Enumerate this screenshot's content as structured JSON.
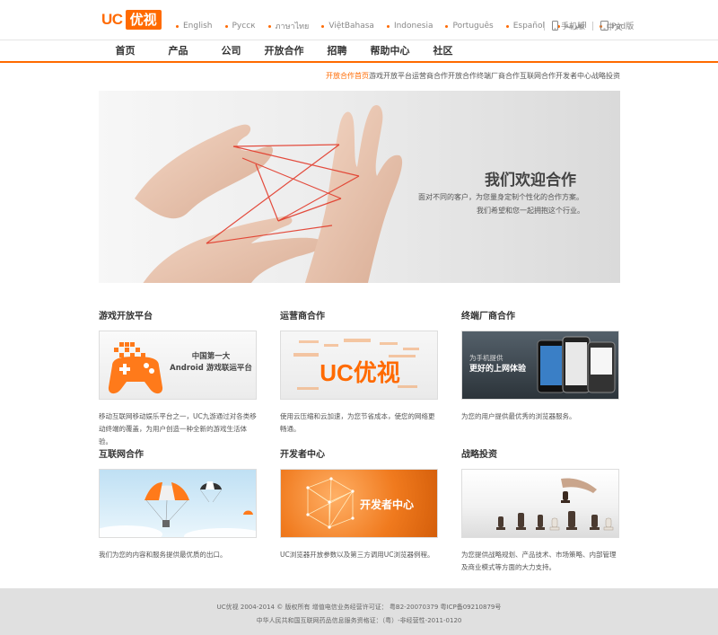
{
  "logo": {
    "uc": "UC",
    "brand": "优视"
  },
  "languages": [
    "English",
    "Русск",
    "ภาษาไทย",
    "ViệtBahasa",
    "Indonesia",
    "Português",
    "Español",
    "العربية",
    "中文"
  ],
  "devices": [
    {
      "label": "手机版",
      "icon": "phone-icon"
    },
    {
      "label": "Pad版",
      "icon": "tablet-icon"
    }
  ],
  "nav": [
    "首页",
    "产品",
    "公司",
    "开放合作",
    "招聘",
    "帮助中心",
    "社区"
  ],
  "nav_active": "开放合作",
  "breadcrumb": {
    "current": "开放合作首页",
    "rest": "游戏开放平台运营商合作开放合作终端厂商合作互联网合作开发者中心战略投资"
  },
  "banner": {
    "title": "我们欢迎合作",
    "sub1": "面对不同的客户，为您量身定制个性化的合作方案。",
    "sub2": "我们希望和您一起拥抱这个行业。"
  },
  "cards": [
    {
      "title": "游戏开放平台",
      "image_text": [
        "中国第一大",
        "Android 游戏联运平台"
      ],
      "desc": "移动互联网移动娱乐平台之一，UC九游通过对各类移动终端的覆盖，为用户创造一种全新的游戏生活体验。"
    },
    {
      "title": "运营商合作",
      "image_text": [
        "UC优视"
      ],
      "desc": "使用云压缩和云加速，为您节省成本，使您的网络更畅通。"
    },
    {
      "title": "终端厂商合作",
      "image_text": [
        "为手机提供",
        "更好的上网体验"
      ],
      "desc": "为您的用户提供最优秀的浏览器服务。"
    },
    {
      "title": "互联网合作",
      "image_text": [],
      "desc": "我们为您的内容和服务提供最优质的出口。"
    },
    {
      "title": "开发者中心",
      "image_text": [
        "开发者中心"
      ],
      "desc": "UC浏览器开放参数以及第三方调用UC浏览器例程。"
    },
    {
      "title": "战略投资",
      "image_text": [],
      "desc": "为您提供战略规划、产品技术、市场策略、内部管理及商业模式等方面的大力支持。"
    }
  ],
  "footer": {
    "line1": "UC优视 2004-2014 © 版权所有 增值电信业务经营许可证： 粤B2-20070379 粤ICP备09210879号",
    "line2": "中华人民共和国互联网药品信息服务资格证：（粤）-非经营性-2011-0120"
  },
  "colors": {
    "accent": "#ff6a00",
    "footer_bg": "#e0e0e0",
    "text": "#333333"
  }
}
